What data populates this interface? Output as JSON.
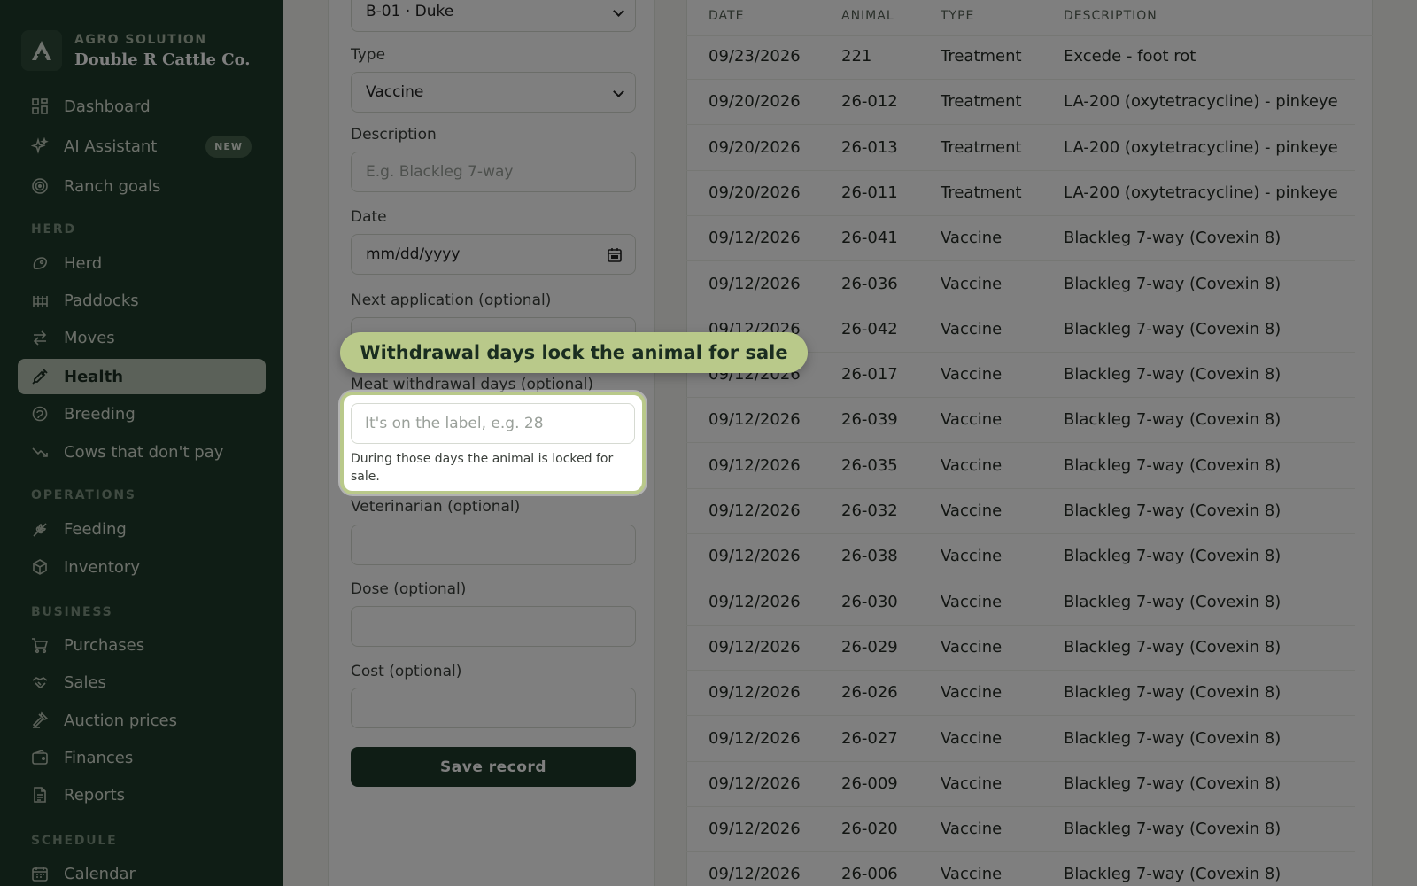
{
  "brand": {
    "company": "AGRO SOLUTION",
    "ranch": "Double R Cattle Co."
  },
  "nav": {
    "dashboard": "Dashboard",
    "ai_assistant": "AI Assistant",
    "ai_badge": "NEW",
    "ranch_goals": "Ranch goals",
    "section_herd": "HERD",
    "herd": "Herd",
    "paddocks": "Paddocks",
    "moves": "Moves",
    "health": "Health",
    "breeding": "Breeding",
    "cows_dont_pay": "Cows that don't pay",
    "section_operations": "OPERATIONS",
    "feeding": "Feeding",
    "inventory": "Inventory",
    "section_business": "BUSINESS",
    "purchases": "Purchases",
    "sales": "Sales",
    "auction_prices": "Auction prices",
    "finances": "Finances",
    "reports": "Reports",
    "section_schedule": "SCHEDULE",
    "calendar": "Calendar"
  },
  "form": {
    "animal_value": "B-01 · Duke",
    "type_label": "Type",
    "type_value": "Vaccine",
    "description_label": "Description",
    "description_placeholder": "E.g. Blackleg 7-way",
    "date_label": "Date",
    "date_placeholder": "mm/dd/yyyy",
    "next_app_label": "Next application (optional)",
    "withdrawal_label": "Meat withdrawal days (optional)",
    "withdrawal_placeholder": "It's on the label, e.g. 28",
    "withdrawal_help": "During those days the animal is locked for sale.",
    "vet_label": "Veterinarian (optional)",
    "dose_label": "Dose (optional)",
    "cost_label": "Cost (optional)",
    "save_label": "Save record"
  },
  "tour": {
    "tooltip": "Withdrawal days lock the animal for sale"
  },
  "table": {
    "headers": [
      "DATE",
      "ANIMAL",
      "TYPE",
      "DESCRIPTION"
    ],
    "rows": [
      [
        "09/23/2026",
        "221",
        "Treatment",
        "Excede - foot rot"
      ],
      [
        "09/20/2026",
        "26-012",
        "Treatment",
        "LA-200 (oxytetracycline) - pinkeye"
      ],
      [
        "09/20/2026",
        "26-013",
        "Treatment",
        "LA-200 (oxytetracycline) - pinkeye"
      ],
      [
        "09/20/2026",
        "26-011",
        "Treatment",
        "LA-200 (oxytetracycline) - pinkeye"
      ],
      [
        "09/12/2026",
        "26-041",
        "Vaccine",
        "Blackleg 7-way (Covexin 8)"
      ],
      [
        "09/12/2026",
        "26-036",
        "Vaccine",
        "Blackleg 7-way (Covexin 8)"
      ],
      [
        "09/12/2026",
        "26-042",
        "Vaccine",
        "Blackleg 7-way (Covexin 8)"
      ],
      [
        "09/12/2026",
        "26-017",
        "Vaccine",
        "Blackleg 7-way (Covexin 8)"
      ],
      [
        "09/12/2026",
        "26-039",
        "Vaccine",
        "Blackleg 7-way (Covexin 8)"
      ],
      [
        "09/12/2026",
        "26-035",
        "Vaccine",
        "Blackleg 7-way (Covexin 8)"
      ],
      [
        "09/12/2026",
        "26-032",
        "Vaccine",
        "Blackleg 7-way (Covexin 8)"
      ],
      [
        "09/12/2026",
        "26-038",
        "Vaccine",
        "Blackleg 7-way (Covexin 8)"
      ],
      [
        "09/12/2026",
        "26-030",
        "Vaccine",
        "Blackleg 7-way (Covexin 8)"
      ],
      [
        "09/12/2026",
        "26-029",
        "Vaccine",
        "Blackleg 7-way (Covexin 8)"
      ],
      [
        "09/12/2026",
        "26-026",
        "Vaccine",
        "Blackleg 7-way (Covexin 8)"
      ],
      [
        "09/12/2026",
        "26-027",
        "Vaccine",
        "Blackleg 7-way (Covexin 8)"
      ],
      [
        "09/12/2026",
        "26-009",
        "Vaccine",
        "Blackleg 7-way (Covexin 8)"
      ],
      [
        "09/12/2026",
        "26-020",
        "Vaccine",
        "Blackleg 7-way (Covexin 8)"
      ],
      [
        "09/12/2026",
        "26-006",
        "Vaccine",
        "Blackleg 7-way (Covexin 8)"
      ]
    ]
  }
}
